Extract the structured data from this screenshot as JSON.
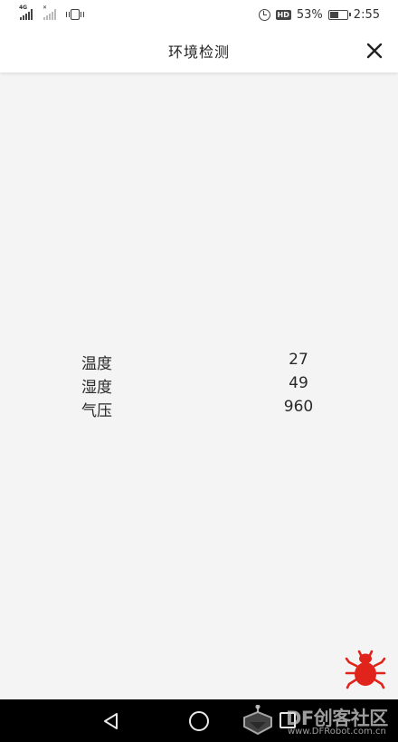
{
  "status_bar": {
    "sim1_tag": "4G",
    "sim2_tag": "✕",
    "hd_label": "HD",
    "battery_text": "53%",
    "time": "2:55"
  },
  "header": {
    "title": "环境检测"
  },
  "readings": [
    {
      "label": "温度",
      "value": "27"
    },
    {
      "label": "湿度",
      "value": "49"
    },
    {
      "label": "气压",
      "value": "960"
    }
  ],
  "watermark": {
    "brand": "DF创客社区",
    "url": "www.DFRobot.com.cn"
  },
  "icons": {
    "close": "close-icon",
    "bug": "bug-icon",
    "back": "back-triangle-icon",
    "home": "home-circle-icon",
    "recent": "recent-square-icon"
  },
  "colors": {
    "bug_red": "#e0241b",
    "background": "#f4f4f4",
    "nav_bar": "#000000"
  },
  "battery_level": 0.53
}
